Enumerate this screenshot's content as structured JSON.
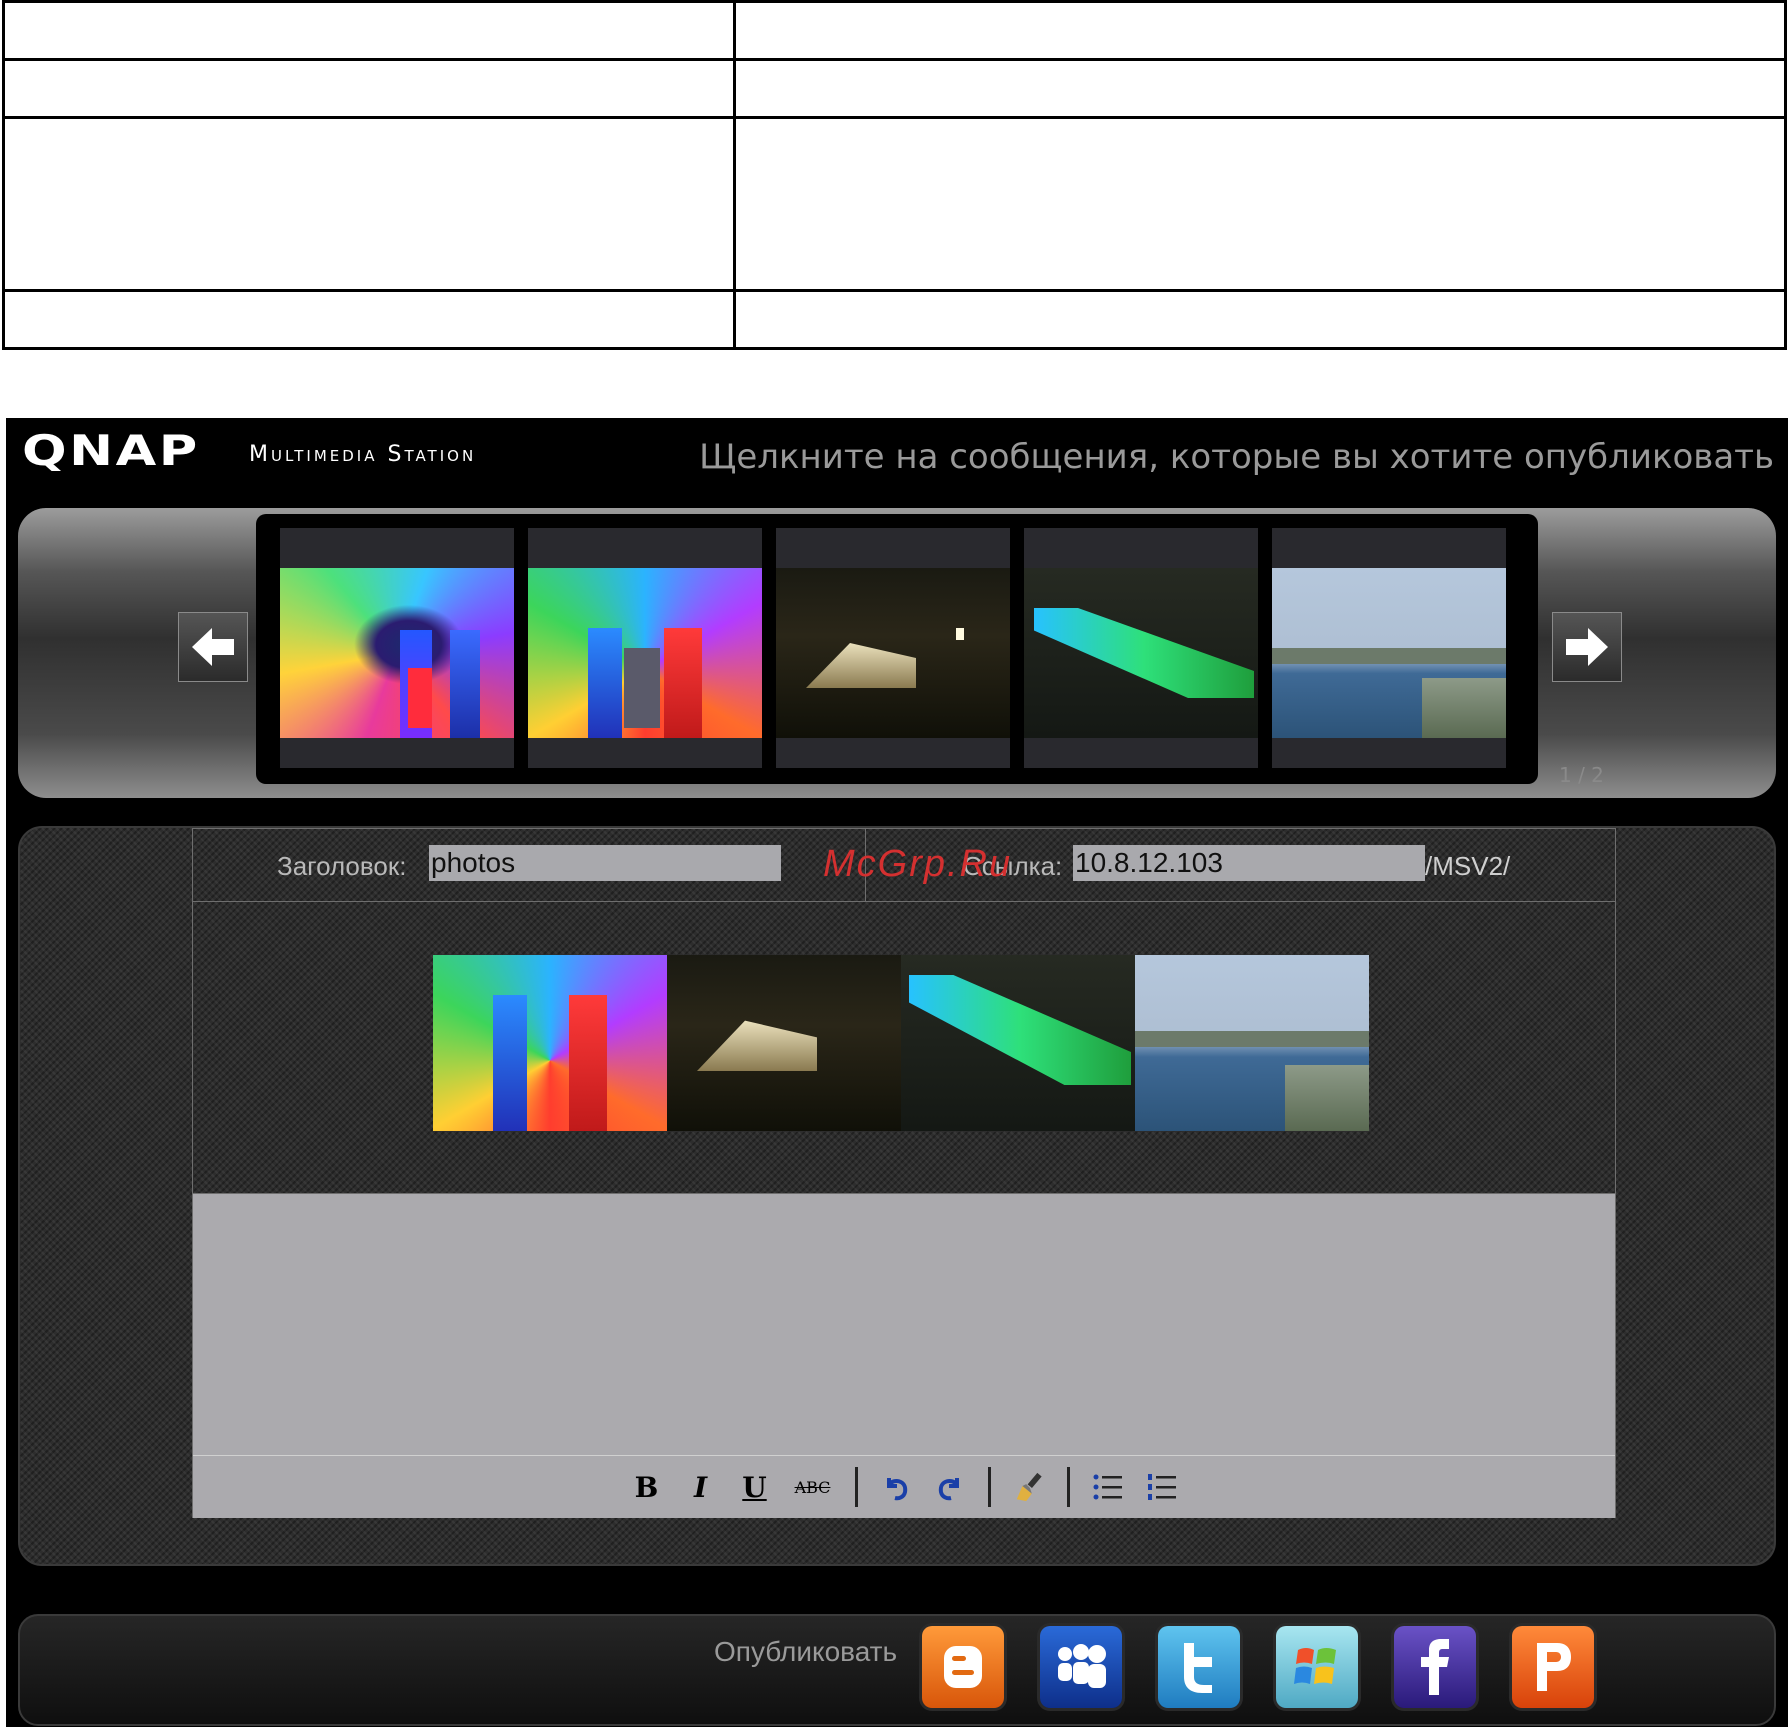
{
  "header": {
    "logo": "QNAP",
    "product": "Multimedia Station",
    "instruction": "Щелкните на сообщения, которые вы хотите опубликовать"
  },
  "carousel": {
    "page_indicator": "1 / 2",
    "prev_icon": "left-arrow-icon",
    "next_icon": "right-arrow-icon"
  },
  "form": {
    "title_label": "Заголовок:",
    "title_value": "photos",
    "link_label": "Ссылка:",
    "link_value": "10.8.12.103",
    "link_suffix": "/MSV2/"
  },
  "watermark": "McGrp.Ru",
  "toolbar": {
    "bold": "B",
    "italic": "I",
    "underline": "U",
    "strike": "ABC"
  },
  "publish": {
    "label": "Опубликовать",
    "services": [
      {
        "name": "blogger",
        "glyph": "B",
        "color": "#ee6a0f"
      },
      {
        "name": "myspace",
        "glyph": "",
        "color": "#1546a8"
      },
      {
        "name": "twitter",
        "glyph": "t",
        "color": "#2b8fd0"
      },
      {
        "name": "windows-live",
        "glyph": "",
        "color": "#6ec3d6"
      },
      {
        "name": "facebook",
        "glyph": "f",
        "color": "#3c2a8c"
      },
      {
        "name": "plurk",
        "glyph": "P",
        "color": "#e04f0e"
      }
    ]
  },
  "colors": {
    "app_bg": "#000000",
    "input_bg": "#a9a9ad",
    "watermark": "#d43030"
  }
}
